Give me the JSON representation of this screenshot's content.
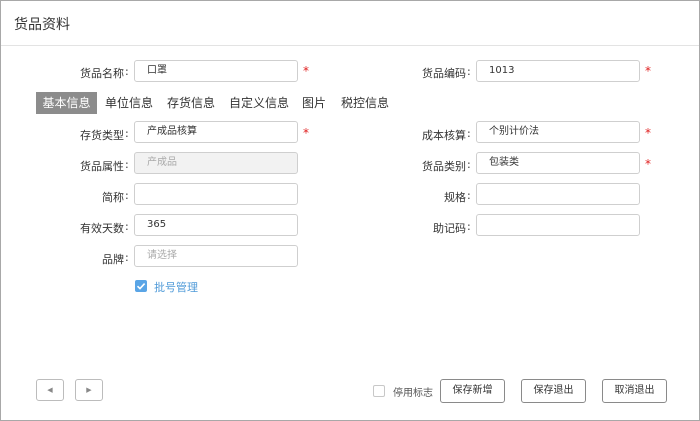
{
  "dialog": {
    "title": "货品资料"
  },
  "top": {
    "name": {
      "label": "货品名称",
      "value": "口罩"
    },
    "code": {
      "label": "货品编码",
      "value": "1013"
    }
  },
  "tabs": [
    "基本信息",
    "单位信息",
    "存货信息",
    "自定义信息",
    "图片",
    "税控信息"
  ],
  "form": {
    "stock_type": {
      "label": "存货类型",
      "value": "产成品核算"
    },
    "cost_calc": {
      "label": "成本核算",
      "value": "个别计价法"
    },
    "attr": {
      "label": "货品属性",
      "value": "产成品"
    },
    "category": {
      "label": "货品类别",
      "value": "包装类"
    },
    "short": {
      "label": "简称",
      "value": ""
    },
    "spec": {
      "label": "规格",
      "value": ""
    },
    "valid_days": {
      "label": "有效天数",
      "value": "365"
    },
    "mnemonic": {
      "label": "助记码",
      "value": ""
    },
    "brand": {
      "label": "品牌",
      "placeholder": "请选择"
    }
  },
  "batch": {
    "label": "批号管理"
  },
  "footer": {
    "prev": "◀",
    "next": "▶",
    "disabled_label": "停用标志",
    "save_new": "保存新增",
    "save_exit": "保存退出",
    "cancel_exit": "取消退出"
  },
  "colors": {
    "required": "#e02020",
    "tab_active": "#8c8c8c",
    "checkbox": "#5aa5e6"
  }
}
